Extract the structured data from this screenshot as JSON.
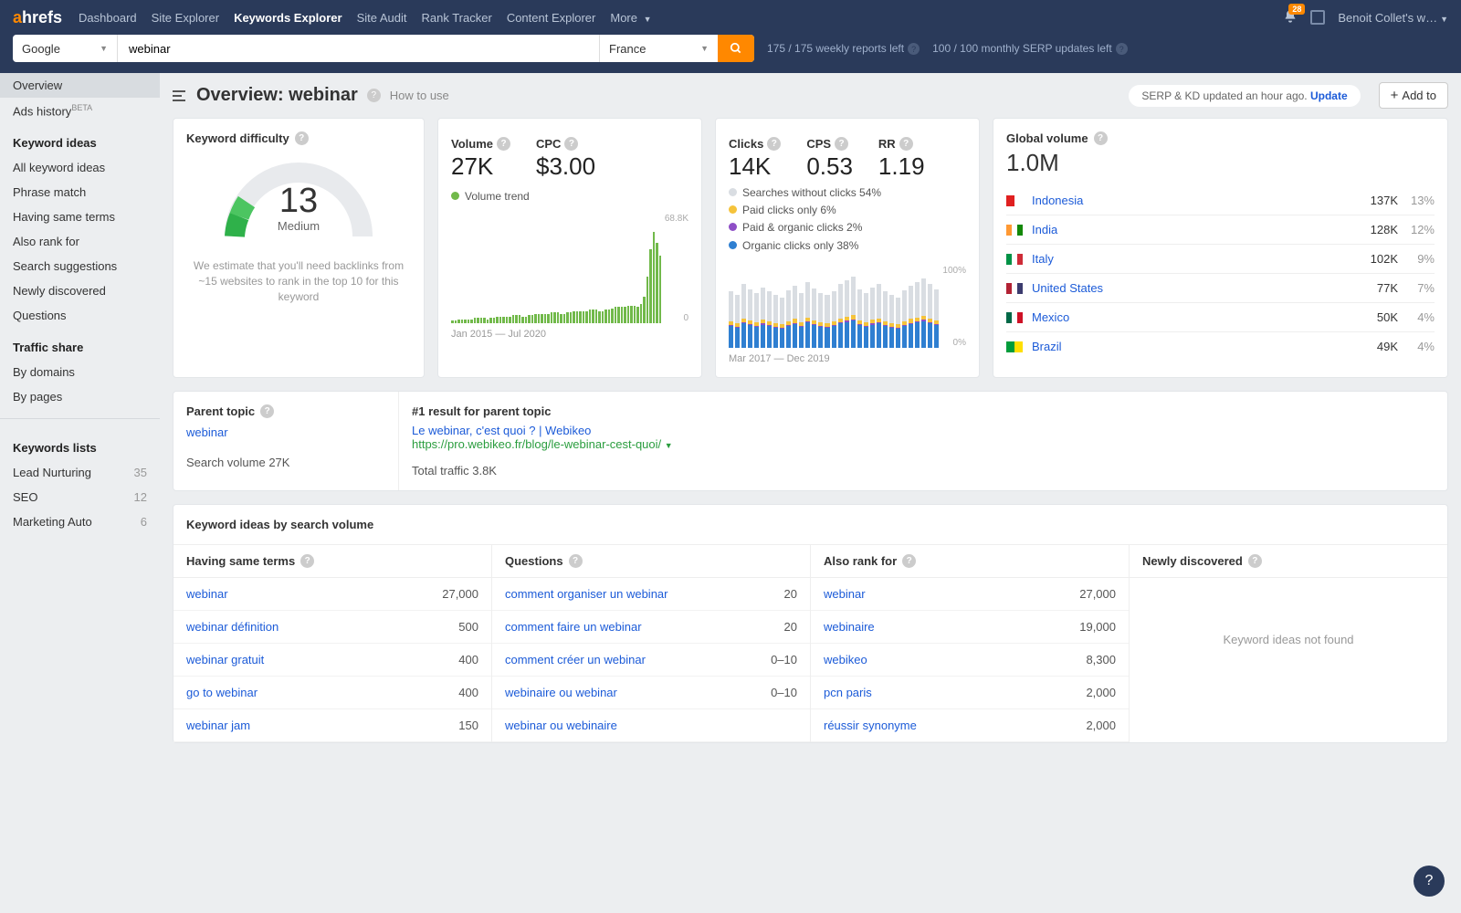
{
  "brand": {
    "a": "a",
    "rest": "hrefs"
  },
  "nav": [
    "Dashboard",
    "Site Explorer",
    "Keywords Explorer",
    "Site Audit",
    "Rank Tracker",
    "Content Explorer",
    "More"
  ],
  "nav_active": 2,
  "notif_count": "28",
  "account": "Benoit Collet's w…",
  "search": {
    "engine": "Google",
    "keyword": "webinar",
    "country": "France",
    "status1": "175 / 175 weekly reports left",
    "status2": "100 / 100 monthly SERP updates left"
  },
  "page": {
    "title_prefix": "Overview: ",
    "title_kw": "webinar",
    "howto": "How to use",
    "serp_text": "SERP & KD updated an hour ago. ",
    "serp_link": "Update",
    "addto": "Add to"
  },
  "sidebar": {
    "overview": "Overview",
    "ads": "Ads history",
    "ads_beta": "BETA",
    "ideas_head": "Keyword ideas",
    "ideas": [
      "All keyword ideas",
      "Phrase match",
      "Having same terms",
      "Also rank for",
      "Search suggestions",
      "Newly discovered",
      "Questions"
    ],
    "traffic_head": "Traffic share",
    "traffic": [
      "By domains",
      "By pages"
    ],
    "lists_head": "Keywords lists",
    "lists": [
      {
        "name": "Lead Nurturing",
        "count": "35"
      },
      {
        "name": "SEO",
        "count": "12"
      },
      {
        "name": "Marketing Auto",
        "count": "6"
      }
    ]
  },
  "kd": {
    "title": "Keyword difficulty",
    "value": "13",
    "label": "Medium",
    "note": "We estimate that you'll need backlinks from ~15 websites to rank in the top 10 for this keyword"
  },
  "vol": {
    "volume_lbl": "Volume",
    "volume": "27K",
    "cpc_lbl": "CPC",
    "cpc": "$3.00",
    "legend": "Volume trend",
    "y_top": "68.8K",
    "y_bot": "0",
    "xaxis": "Jan 2015 — Jul 2020"
  },
  "clicks": {
    "clicks_lbl": "Clicks",
    "clicks": "14K",
    "cps_lbl": "CPS",
    "cps": "0.53",
    "rr_lbl": "RR",
    "rr": "1.19",
    "legend": [
      {
        "color": "#d9dde2",
        "text": "Searches without clicks 54%"
      },
      {
        "color": "#f5c33b",
        "text": "Paid clicks only 6%"
      },
      {
        "color": "#8e4ec6",
        "text": "Paid & organic clicks 2%"
      },
      {
        "color": "#2f7fd1",
        "text": "Organic clicks only 38%"
      }
    ],
    "y_top": "100%",
    "y_bot": "0%",
    "xaxis": "Mar 2017 — Dec 2019"
  },
  "gv": {
    "title": "Global volume",
    "total": "1.0M",
    "rows": [
      {
        "flag": "#e02020,#ffffff",
        "country": "Indonesia",
        "vol": "137K",
        "pct": "13%"
      },
      {
        "flag": "#ff9933,#ffffff,#138808",
        "country": "India",
        "vol": "128K",
        "pct": "12%"
      },
      {
        "flag": "#009246,#ffffff,#ce2b37",
        "country": "Italy",
        "vol": "102K",
        "pct": "9%"
      },
      {
        "flag": "#b22234,#ffffff,#3c3b6e",
        "country": "United States",
        "vol": "77K",
        "pct": "7%"
      },
      {
        "flag": "#006847,#ffffff,#ce1126",
        "country": "Mexico",
        "vol": "50K",
        "pct": "4%"
      },
      {
        "flag": "#009c3b,#ffdf00",
        "country": "Brazil",
        "vol": "49K",
        "pct": "4%"
      }
    ]
  },
  "parent": {
    "title": "Parent topic",
    "link": "webinar",
    "sv": "Search volume 27K",
    "r1_title": "#1 result for parent topic",
    "r1_link": "Le webinar, c'est quoi ? | Webikeo",
    "r1_url": "https://pro.webikeo.fr/blog/le-webinar-cest-quoi/",
    "r1_traffic": "Total traffic 3.8K"
  },
  "ki": {
    "title": "Keyword ideas by search volume",
    "cols": [
      {
        "head": "Having same terms",
        "items": [
          {
            "kw": "webinar",
            "n": "27,000"
          },
          {
            "kw": "webinar définition",
            "n": "500"
          },
          {
            "kw": "webinar gratuit",
            "n": "400"
          },
          {
            "kw": "go to webinar",
            "n": "400"
          },
          {
            "kw": "webinar jam",
            "n": "150"
          }
        ]
      },
      {
        "head": "Questions",
        "items": [
          {
            "kw": "comment organiser un webinar",
            "n": "20"
          },
          {
            "kw": "comment faire un webinar",
            "n": "20"
          },
          {
            "kw": "comment créer un webinar",
            "n": "0–10"
          },
          {
            "kw": "webinaire ou webinar",
            "n": "0–10"
          },
          {
            "kw": "webinar ou webinaire",
            "n": ""
          }
        ]
      },
      {
        "head": "Also rank for",
        "items": [
          {
            "kw": "webinar",
            "n": "27,000"
          },
          {
            "kw": "webinaire",
            "n": "19,000"
          },
          {
            "kw": "webikeo",
            "n": "8,300"
          },
          {
            "kw": "pcn paris",
            "n": "2,000"
          },
          {
            "kw": "réussir synonyme",
            "n": "2,000"
          }
        ]
      },
      {
        "head": "Newly discovered",
        "empty": "Keyword ideas not found"
      }
    ]
  },
  "chart_data": {
    "volume_trend": {
      "type": "bar",
      "title": "Volume trend",
      "x_range": [
        "Jan 2015",
        "Jul 2020"
      ],
      "ylim": [
        0,
        68800
      ],
      "values": [
        2,
        2,
        3,
        3,
        3,
        3,
        3,
        4,
        4,
        4,
        4,
        3,
        4,
        4,
        5,
        5,
        5,
        5,
        5,
        6,
        6,
        6,
        5,
        5,
        6,
        6,
        7,
        7,
        7,
        7,
        7,
        8,
        8,
        8,
        7,
        7,
        8,
        8,
        9,
        9,
        9,
        9,
        9,
        10,
        10,
        10,
        9,
        9,
        10,
        10,
        11,
        12,
        12,
        12,
        12,
        13,
        13,
        13,
        12,
        14,
        20,
        35,
        55,
        68,
        60,
        50
      ]
    },
    "clicks_stack": {
      "type": "stacked-bar",
      "x_range": [
        "Mar 2017",
        "Dec 2019"
      ],
      "ylim_pct": [
        0,
        100
      ],
      "series_colors": {
        "no_click": "#d9dde2",
        "paid": "#f5c33b",
        "both": "#8e4ec6",
        "organic": "#2f7fd1"
      },
      "bars": [
        {
          "h": 62,
          "no": 54,
          "pd": 6,
          "bo": 2,
          "or": 38
        },
        {
          "h": 58,
          "no": 54,
          "pd": 6,
          "bo": 2,
          "or": 38
        },
        {
          "h": 70,
          "no": 54,
          "pd": 6,
          "bo": 2,
          "or": 38
        },
        {
          "h": 64,
          "no": 54,
          "pd": 6,
          "bo": 2,
          "or": 38
        },
        {
          "h": 60,
          "no": 54,
          "pd": 6,
          "bo": 2,
          "or": 38
        },
        {
          "h": 66,
          "no": 54,
          "pd": 6,
          "bo": 2,
          "or": 38
        },
        {
          "h": 62,
          "no": 54,
          "pd": 6,
          "bo": 2,
          "or": 38
        },
        {
          "h": 58,
          "no": 54,
          "pd": 6,
          "bo": 2,
          "or": 38
        },
        {
          "h": 55,
          "no": 54,
          "pd": 6,
          "bo": 2,
          "or": 38
        },
        {
          "h": 63,
          "no": 54,
          "pd": 6,
          "bo": 2,
          "or": 38
        },
        {
          "h": 68,
          "no": 54,
          "pd": 6,
          "bo": 2,
          "or": 38
        },
        {
          "h": 60,
          "no": 54,
          "pd": 6,
          "bo": 2,
          "or": 38
        },
        {
          "h": 72,
          "no": 54,
          "pd": 6,
          "bo": 2,
          "or": 38
        },
        {
          "h": 65,
          "no": 54,
          "pd": 6,
          "bo": 2,
          "or": 38
        },
        {
          "h": 60,
          "no": 54,
          "pd": 6,
          "bo": 2,
          "or": 38
        },
        {
          "h": 58,
          "no": 54,
          "pd": 6,
          "bo": 2,
          "or": 38
        },
        {
          "h": 62,
          "no": 54,
          "pd": 6,
          "bo": 2,
          "or": 38
        },
        {
          "h": 70,
          "no": 54,
          "pd": 6,
          "bo": 2,
          "or": 38
        },
        {
          "h": 74,
          "no": 54,
          "pd": 6,
          "bo": 2,
          "or": 38
        },
        {
          "h": 78,
          "no": 54,
          "pd": 6,
          "bo": 2,
          "or": 38
        },
        {
          "h": 64,
          "no": 54,
          "pd": 6,
          "bo": 2,
          "or": 38
        },
        {
          "h": 60,
          "no": 54,
          "pd": 6,
          "bo": 2,
          "or": 38
        },
        {
          "h": 66,
          "no": 54,
          "pd": 6,
          "bo": 2,
          "or": 38
        },
        {
          "h": 70,
          "no": 54,
          "pd": 6,
          "bo": 2,
          "or": 38
        },
        {
          "h": 62,
          "no": 54,
          "pd": 6,
          "bo": 2,
          "or": 38
        },
        {
          "h": 58,
          "no": 54,
          "pd": 6,
          "bo": 2,
          "or": 38
        },
        {
          "h": 55,
          "no": 54,
          "pd": 6,
          "bo": 2,
          "or": 38
        },
        {
          "h": 63,
          "no": 54,
          "pd": 6,
          "bo": 2,
          "or": 38
        },
        {
          "h": 68,
          "no": 54,
          "pd": 6,
          "bo": 2,
          "or": 38
        },
        {
          "h": 72,
          "no": 54,
          "pd": 6,
          "bo": 2,
          "or": 38
        },
        {
          "h": 76,
          "no": 54,
          "pd": 6,
          "bo": 2,
          "or": 38
        },
        {
          "h": 70,
          "no": 54,
          "pd": 6,
          "bo": 2,
          "or": 38
        },
        {
          "h": 64,
          "no": 54,
          "pd": 6,
          "bo": 2,
          "or": 38
        }
      ]
    }
  }
}
